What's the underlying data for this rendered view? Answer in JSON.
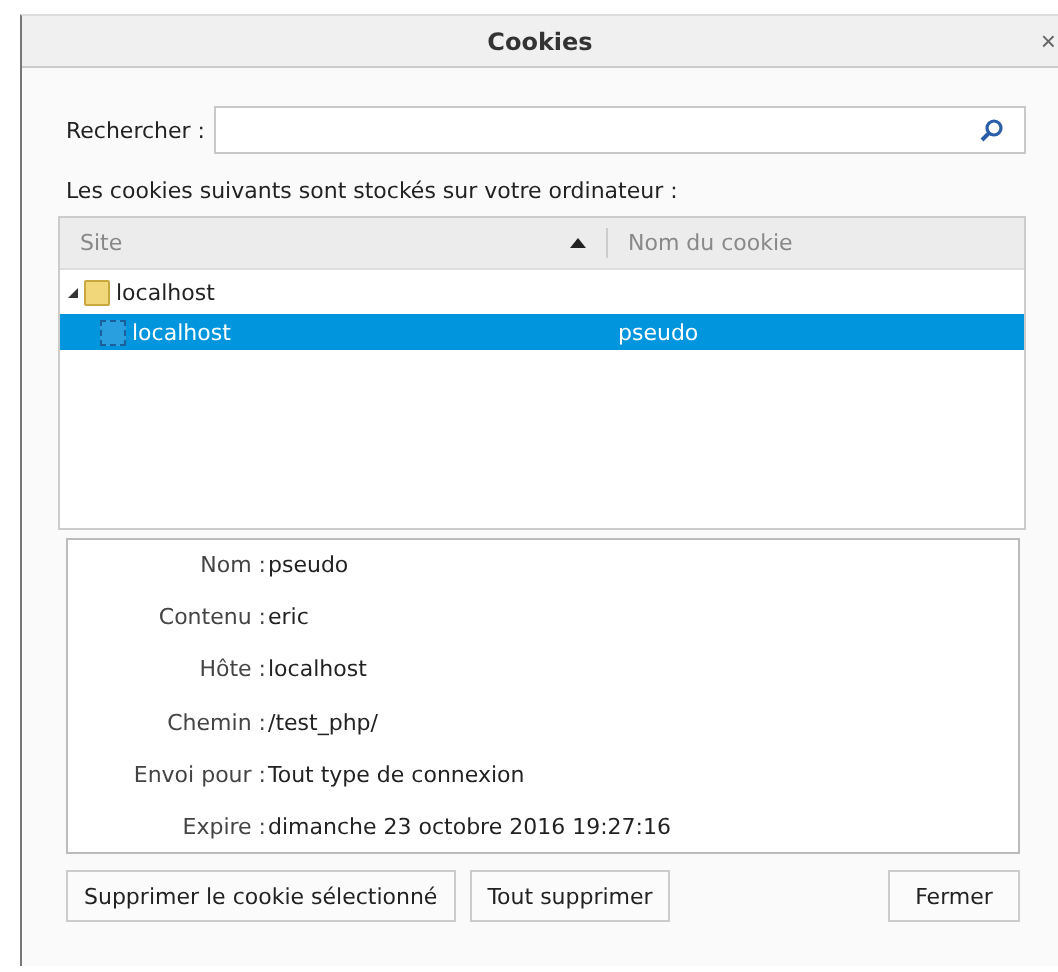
{
  "window": {
    "title": "Cookies",
    "close": "×"
  },
  "search": {
    "label": "Rechercher :"
  },
  "description": "Les cookies suivants sont stockés sur votre ordinateur :",
  "tree": {
    "columns": [
      {
        "label": "Site",
        "sorted": true
      },
      {
        "label": "Nom du cookie",
        "sorted": false
      }
    ],
    "rows": [
      {
        "kind": "folder",
        "site": "localhost",
        "expanded": true,
        "selected": false,
        "children": [
          {
            "kind": "cookie",
            "site": "localhost",
            "name": "pseudo",
            "selected": true
          }
        ]
      }
    ]
  },
  "details": [
    {
      "label": "Nom :",
      "value": "pseudo"
    },
    {
      "label": "Contenu :",
      "value": "eric"
    },
    {
      "label": "Hôte :",
      "value": "localhost"
    },
    {
      "label": "Chemin :",
      "value": "/test_php/"
    },
    {
      "label": "Envoi pour :",
      "value": "Tout type de connexion"
    },
    {
      "label": "Expire :",
      "value": "dimanche 23 octobre 2016 19:27:16"
    }
  ],
  "buttons": {
    "left": [
      "Supprimer le cookie sélectionné",
      "Tout supprimer"
    ],
    "right": [
      "Fermer"
    ]
  }
}
